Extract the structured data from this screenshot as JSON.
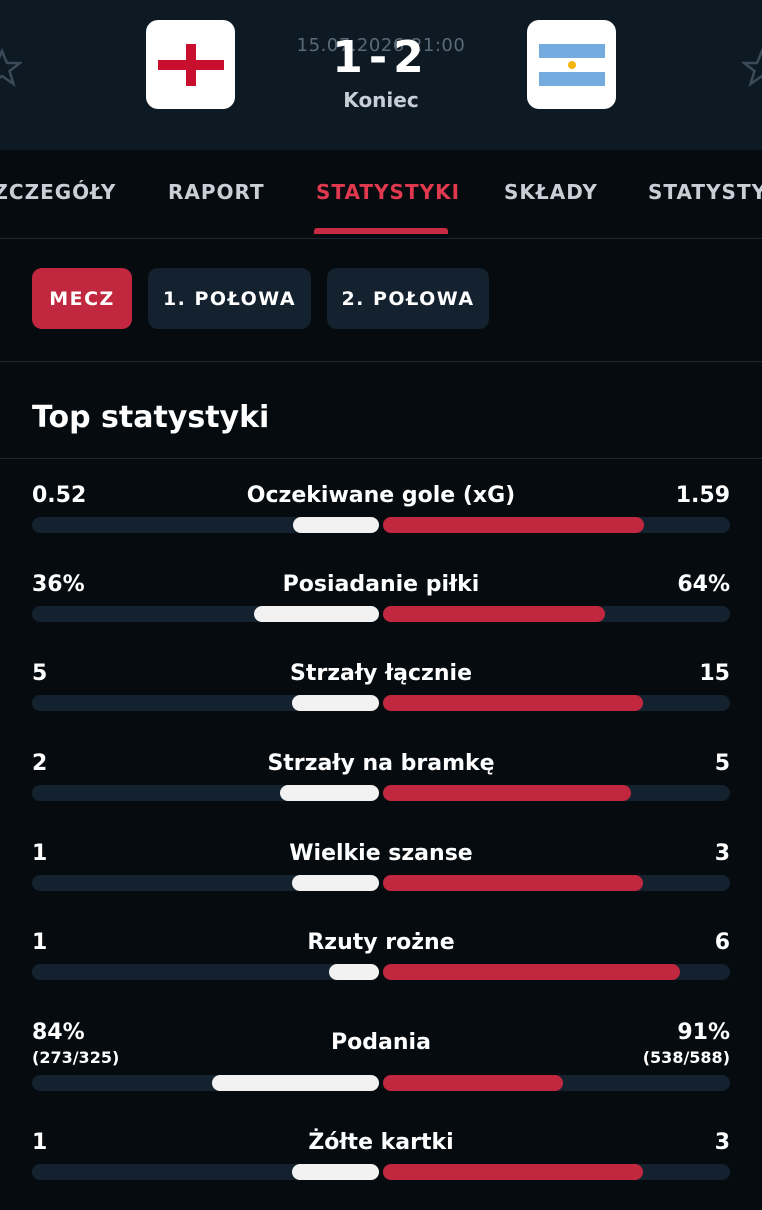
{
  "match": {
    "date_time": "15.07.2026 21:00",
    "score": "1-2",
    "status": "Koniec",
    "home_icon": "england-flag-icon",
    "away_icon": "argentina-flag-icon"
  },
  "tabs": [
    "SZCZEGÓŁY",
    "RAPORT",
    "STATYSTYKI",
    "SKŁADY",
    "STATYSTYKI"
  ],
  "periods": [
    "MECZ",
    "1. POŁOWA",
    "2. POŁOWA"
  ],
  "section_title": "Top statystyki",
  "colors": {
    "accent": "#c1283f",
    "home_bar": "#f2f2f2",
    "track": "#13222e"
  },
  "stats": [
    {
      "label": "Oczekiwane gole (xG)",
      "home": "0.52",
      "away": "1.59",
      "home_share": 0.247,
      "away_share": 0.753
    },
    {
      "label": "Posiadanie piłki",
      "home": "36%",
      "away": "64%",
      "home_share": 0.36,
      "away_share": 0.64
    },
    {
      "label": "Strzały łącznie",
      "home": "5",
      "away": "15",
      "home_share": 0.25,
      "away_share": 0.75
    },
    {
      "label": "Strzały na bramkę",
      "home": "2",
      "away": "5",
      "home_share": 0.286,
      "away_share": 0.714
    },
    {
      "label": "Wielkie szanse",
      "home": "1",
      "away": "3",
      "home_share": 0.25,
      "away_share": 0.75
    },
    {
      "label": "Rzuty rożne",
      "home": "1",
      "away": "6",
      "home_share": 0.143,
      "away_share": 0.857
    },
    {
      "label": "Podania",
      "home": "84%",
      "away": "91%",
      "home_sub": "(273/325)",
      "away_sub": "(538/588)",
      "home_share": 0.48,
      "away_share": 0.52
    },
    {
      "label": "Żółte kartki",
      "home": "1",
      "away": "3",
      "home_share": 0.25,
      "away_share": 0.75
    }
  ]
}
